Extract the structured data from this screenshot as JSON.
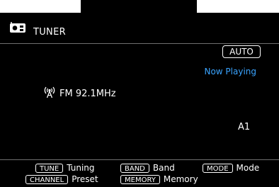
{
  "header": {
    "title": "TUNER"
  },
  "status": {
    "mode_badge": "AUTO",
    "now_playing": "Now Playing"
  },
  "station": {
    "frequency": "FM 92.1MHz",
    "preset": "A1"
  },
  "legend": [
    {
      "key": "TUNE",
      "label": "Tuning"
    },
    {
      "key": "BAND",
      "label": "Band"
    },
    {
      "key": "MODE",
      "label": "Mode"
    },
    {
      "key": "CHANNEL",
      "label": "Preset"
    },
    {
      "key": "MEMORY",
      "label": "Memory"
    }
  ],
  "icons": {
    "source": "radio-icon",
    "antenna": "antenna-icon"
  },
  "colors": {
    "background": "#000000",
    "text": "#ffffff",
    "accent": "#3aa4ff"
  }
}
